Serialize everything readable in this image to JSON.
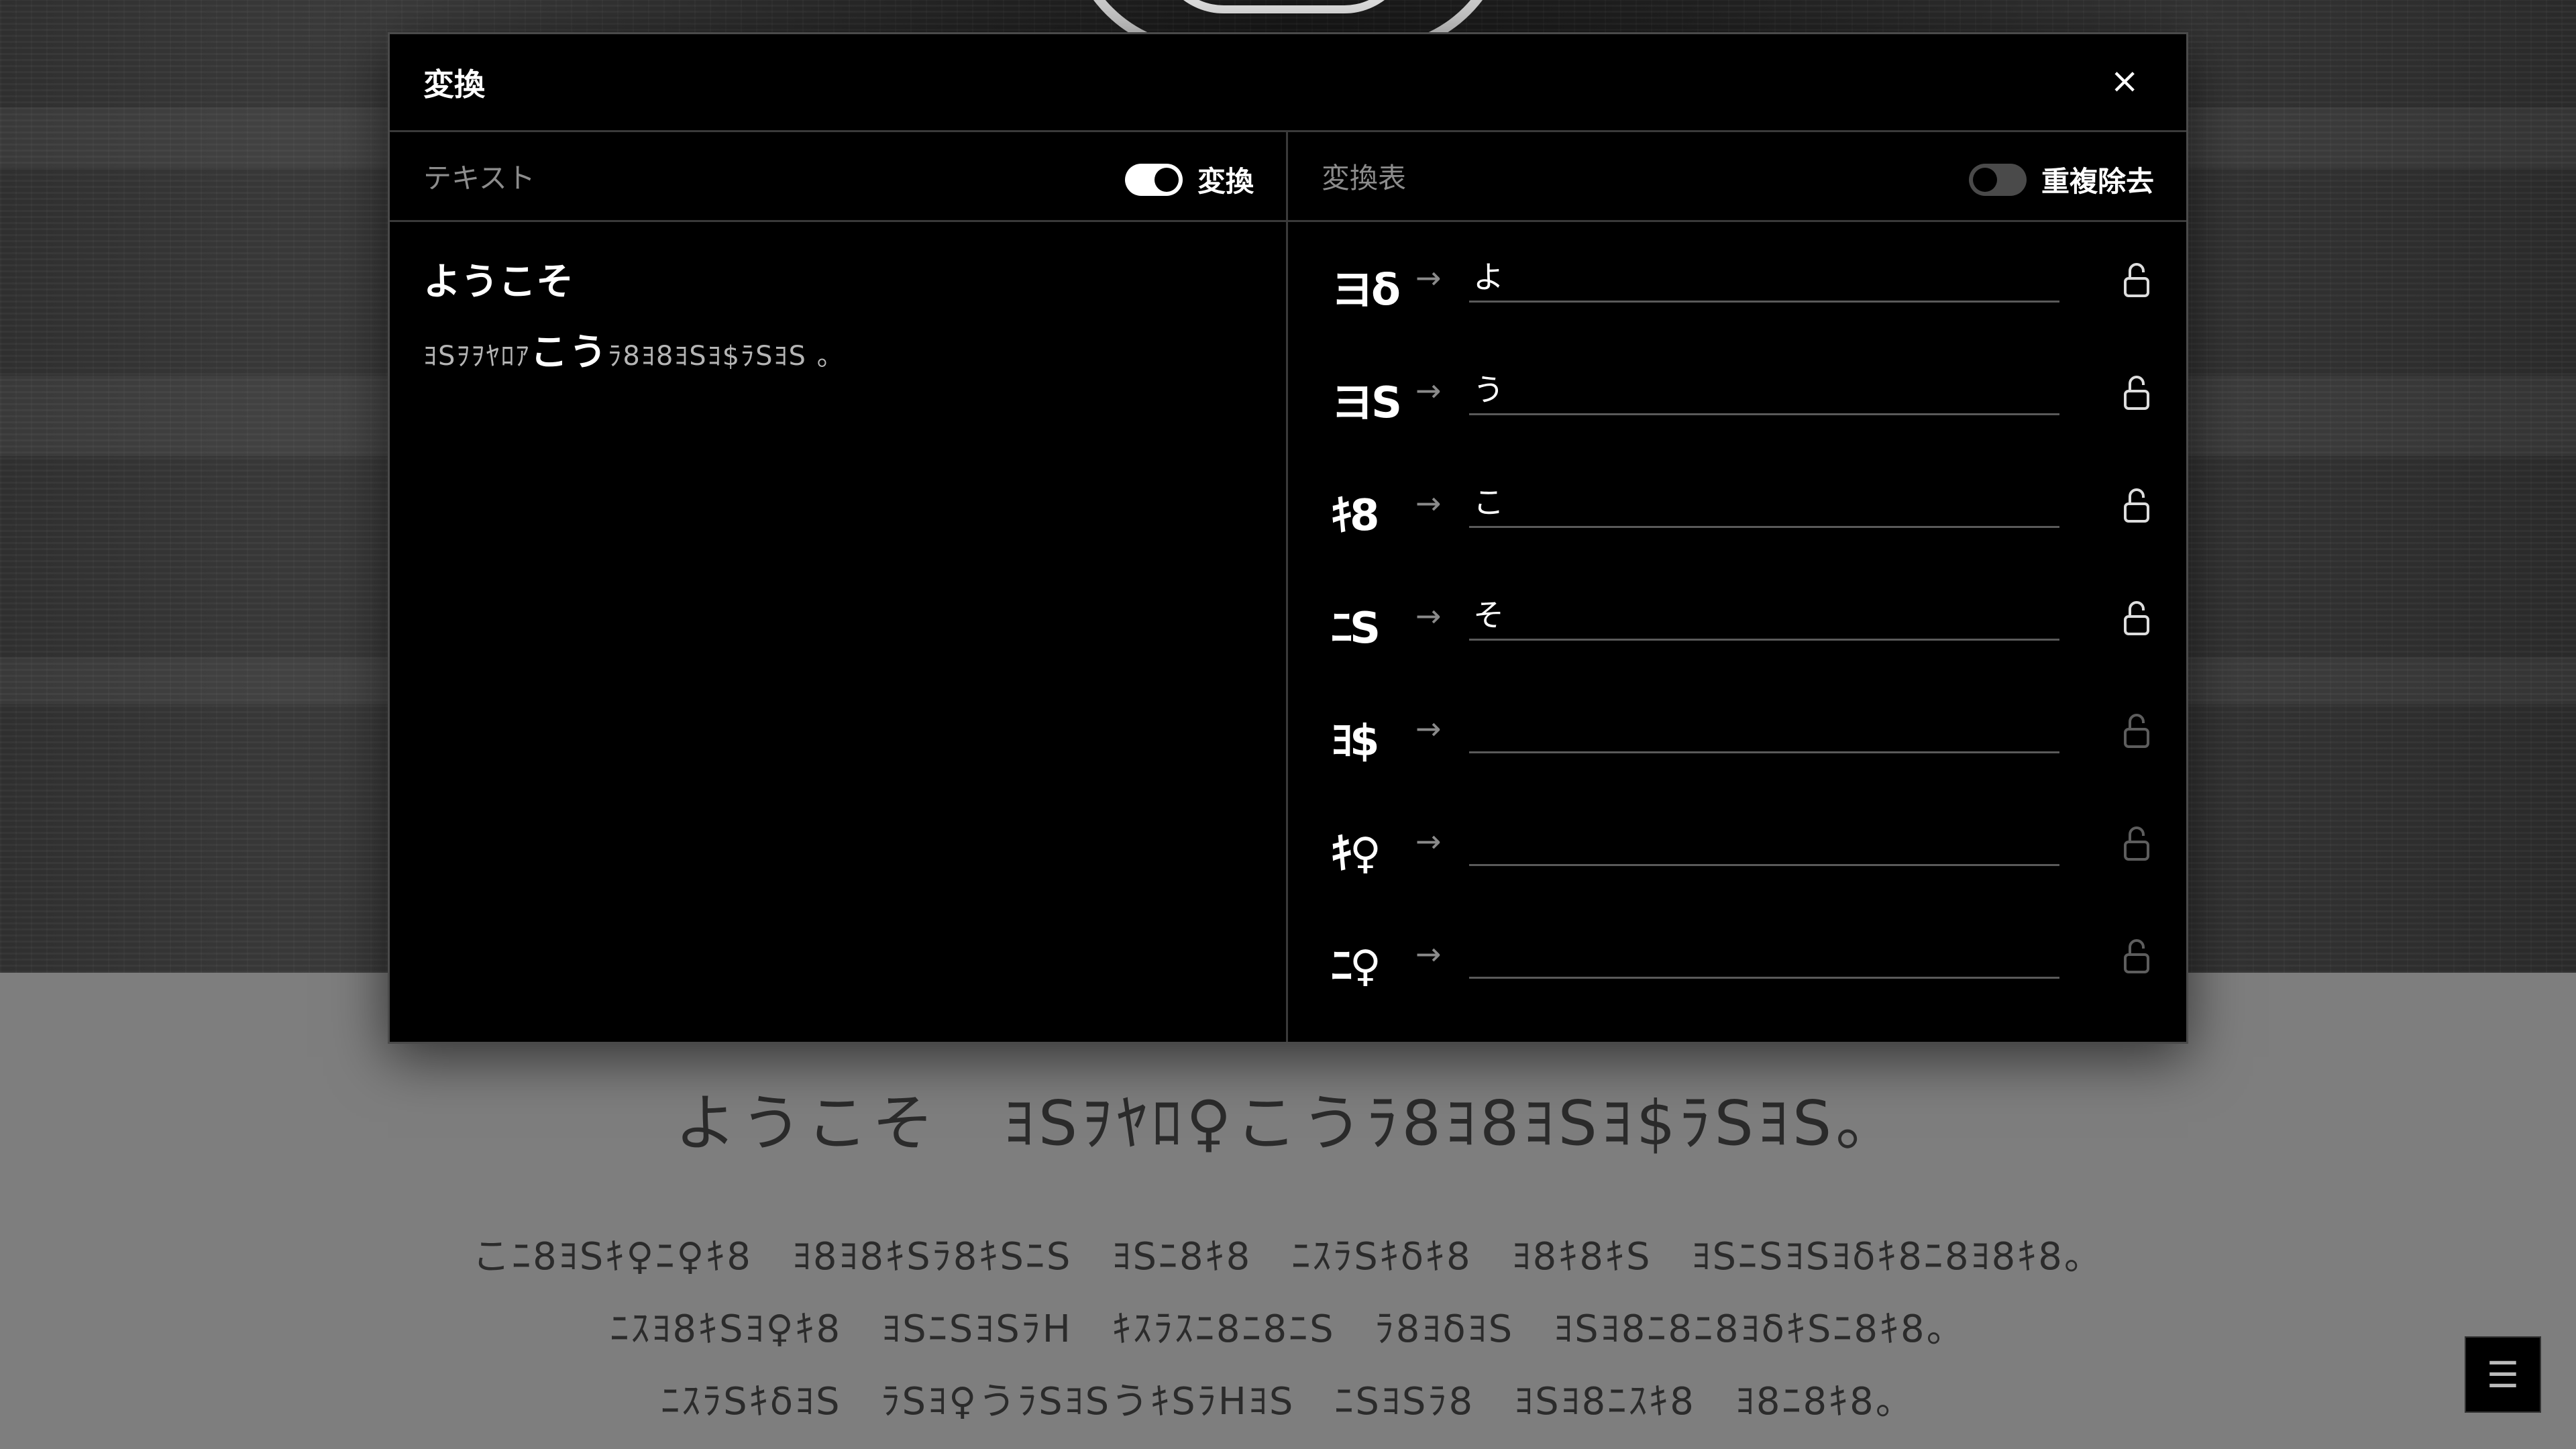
{
  "modal": {
    "title": "変換",
    "close_label": "×",
    "text_pane": {
      "label": "テキスト",
      "toggle_label": "変換",
      "toggle_on": true,
      "input_text": "ようこそ",
      "output_prefix": "ﾖSｦｦﾔﾛｱ",
      "output_converted": "こう",
      "output_suffix": "ﾗ8ﾖ8ﾖSﾖ$ﾗSﾖS 。"
    },
    "table_pane": {
      "label": "変換表",
      "toggle_label": "重複除去",
      "toggle_on": false,
      "rows": [
        {
          "glyph": "ヨδ",
          "value": "よ",
          "locked": false,
          "active": true
        },
        {
          "glyph": "ヨS",
          "value": "う",
          "locked": false,
          "active": true
        },
        {
          "glyph": "ｷ8",
          "value": "こ",
          "locked": false,
          "active": true
        },
        {
          "glyph": "ﾆS",
          "value": "そ",
          "locked": false,
          "active": true
        },
        {
          "glyph": "ﾖ$",
          "value": "",
          "locked": false,
          "active": false
        },
        {
          "glyph": "ｷ♀",
          "value": "",
          "locked": false,
          "active": false
        },
        {
          "glyph": "ﾆ♀",
          "value": "",
          "locked": false,
          "active": false
        }
      ],
      "arrow": "→"
    }
  },
  "background": {
    "heading": "ようこそ　ﾖSｦﾔﾛ♀こうﾗ8ﾖ8ﾖSﾖ$ﾗSﾖS。",
    "paragraph_lines": [
      "こﾆ8ﾖSｷ♀ﾆ♀ｷ8　ﾖ8ﾖ8ｷSﾗ8ｷSﾆS　ﾖSﾆ8ｷ8　ﾆｽﾗSｷδｷ8　ﾖ8ｷ8ｷS　ﾖSﾆSﾖSﾖδｷ8ﾆ8ﾖ8ｷ8。",
      "ﾆｽﾖ8ｷSﾖ♀ｷ8　ﾖSﾆSﾖSﾗH　ｷｽﾗｽﾆ8ﾆ8ﾆS　ﾗ8ﾖδﾖS　ﾖSﾖ8ﾆ8ﾆ8ﾖδｷSﾆ8ｷ8。",
      "ﾆｽﾗSｷδﾖS　ﾗSﾖ♀うﾗSﾖSうｷSﾗHﾖS　ﾆSﾖSﾗ8　ﾖSﾖ8ﾆｽｷ8　ﾖ8ﾆ8ｷ8。"
    ],
    "menu_icon": "hamburger-icon"
  }
}
